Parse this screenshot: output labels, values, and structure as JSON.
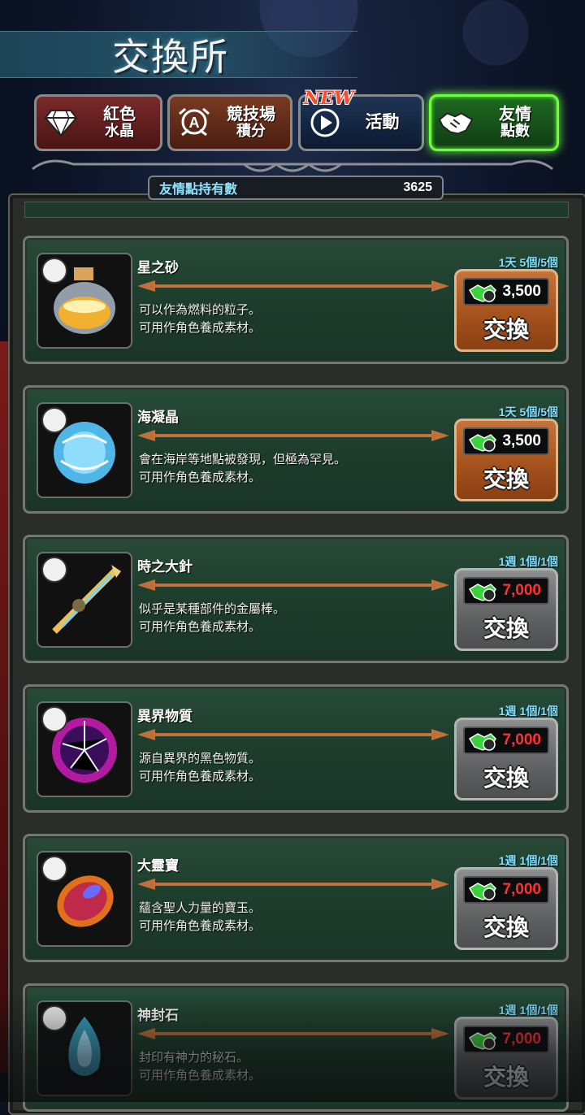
{
  "header": {
    "title": "交換所"
  },
  "tabs": [
    {
      "line1": "紅色",
      "line2": "水晶",
      "icon": "diamond-icon",
      "selected": false
    },
    {
      "line1": "競技場",
      "line2": "積分",
      "icon": "arena-emblem-icon",
      "selected": false
    },
    {
      "line1": "活動",
      "line2": "",
      "icon": "event-play-icon",
      "selected": false,
      "badge": "NEW"
    },
    {
      "line1": "友情",
      "line2": "點數",
      "icon": "handshake-icon",
      "selected": true
    }
  ],
  "points": {
    "label": "友情點持有數",
    "value": "3625"
  },
  "items": [
    {
      "name": "星之砂",
      "desc1": "可以作為燃料的粒子。",
      "desc2": "可用作角色養成素材。",
      "limit": "1天 5個/5個",
      "price": "3,500",
      "affordable": true,
      "button": "交換",
      "icon": "star-sand-bottle-icon"
    },
    {
      "name": "海凝晶",
      "desc1": "會在海岸等地點被發現，但極為罕見。",
      "desc2": "可用作角色養成素材。",
      "limit": "1天 5個/5個",
      "price": "3,500",
      "affordable": true,
      "button": "交換",
      "icon": "sea-crystal-icon"
    },
    {
      "name": "時之大針",
      "desc1": "似乎是某種部件的金屬棒。",
      "desc2": "可用作角色養成素材。",
      "limit": "1週 1個/1個",
      "price": "7,000",
      "affordable": false,
      "button": "交換",
      "icon": "time-needle-icon"
    },
    {
      "name": "異界物質",
      "desc1": "源自異界的黑色物質。",
      "desc2": "可用作角色養成素材。",
      "limit": "1週 1個/1個",
      "price": "7,000",
      "affordable": false,
      "button": "交換",
      "icon": "otherworld-matter-icon"
    },
    {
      "name": "大靈寶",
      "desc1": "蘊含聖人力量的寶玉。",
      "desc2": "可用作角色養成素材。",
      "limit": "1週 1個/1個",
      "price": "7,000",
      "affordable": false,
      "button": "交換",
      "icon": "great-spirit-gem-icon"
    },
    {
      "name": "神封石",
      "desc1": "封印有神力的秘石。",
      "desc2": "可用作角色養成素材。",
      "limit": "1週 1個/1個",
      "price": "7,000",
      "affordable": false,
      "button": "交換",
      "icon": "divine-seal-stone-icon"
    }
  ],
  "colors": {
    "accent_green": "#6cff3a",
    "price_insufficient": "#ff3030",
    "limit_text": "#7fe0ff"
  }
}
